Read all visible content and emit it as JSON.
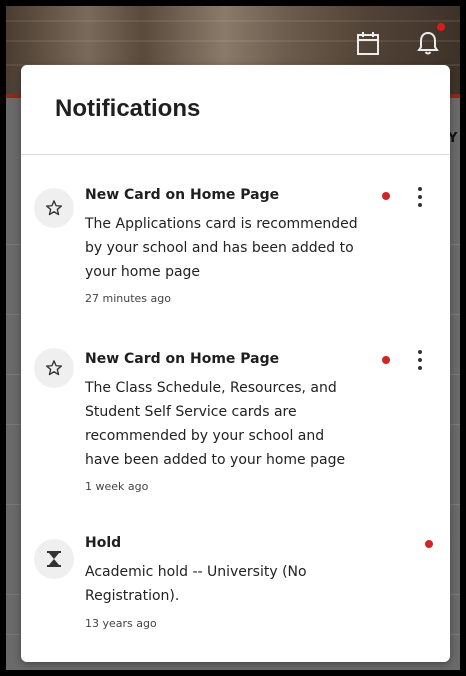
{
  "header": {
    "calendar_icon": "calendar-icon",
    "bell_icon": "bell-icon",
    "bell_has_unread": true
  },
  "panel": {
    "title": "Notifications"
  },
  "notifications": [
    {
      "icon": "star-outline-icon",
      "title": "New Card on Home Page",
      "body_lines": [
        "The Applications card is recommended",
        "by your school and has been added to",
        "your home page"
      ],
      "time": "27 minutes ago",
      "unread": true,
      "has_menu": true
    },
    {
      "icon": "star-outline-icon",
      "title": "New Card on Home Page",
      "body_lines": [
        "The Class Schedule, Resources, and",
        "Student Self Service cards are",
        "recommended by your school and",
        "have been added to your home page"
      ],
      "time": "1 week ago",
      "unread": true,
      "has_menu": true
    },
    {
      "icon": "hourglass-icon",
      "title": "Hold",
      "body_lines": [
        "Academic hold -- University (No",
        "Registration)."
      ],
      "time": "13 years ago",
      "unread": true,
      "has_menu": false
    }
  ],
  "background": {
    "partial_letter": "Y"
  },
  "colors": {
    "unread_dot": "#d22424",
    "panel_bg": "#ffffff"
  }
}
